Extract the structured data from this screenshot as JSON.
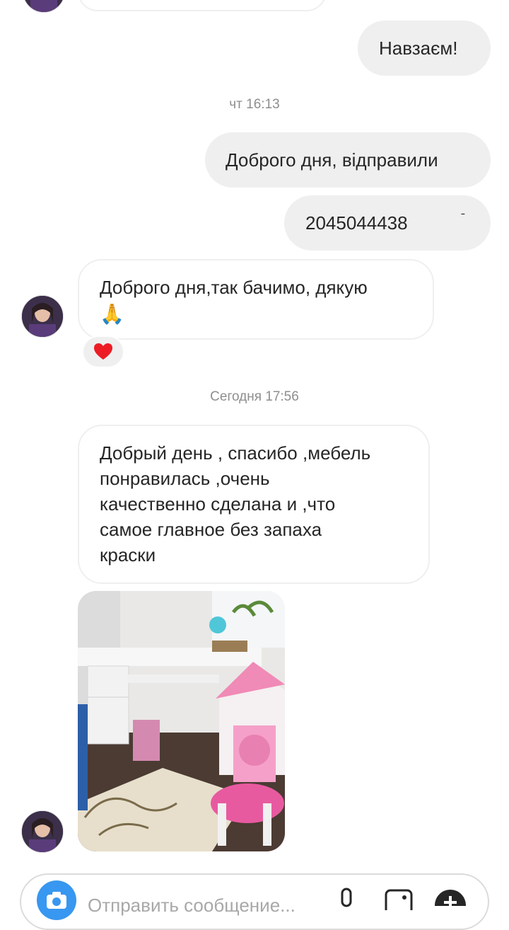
{
  "messages": {
    "out_1": "Навзаєм!",
    "time_1": "чт 16:13",
    "out_2": "Доброго дня, відправили",
    "out_3": "2045044438",
    "in_1_line1": "Доброго дня,так бачимо, дякую",
    "in_1_emoji": "🙏",
    "reaction": "❤",
    "time_2": "Сегодня 17:56",
    "in_2_lines": [
      "Добрый день , спасибо ,мебель",
      "понравилась ,очень",
      "качественно сделана и ,что",
      "самое главное без запаха",
      "краски"
    ]
  },
  "composer": {
    "placeholder": "Отправить сообщение..."
  },
  "icons": {
    "camera": "camera-icon",
    "mic": "microphone-icon",
    "gallery": "gallery-icon",
    "plus": "plus-icon"
  },
  "colors": {
    "accent": "#3897f0",
    "reaction": "#ed1c24",
    "bubble_out": "#efefef"
  }
}
